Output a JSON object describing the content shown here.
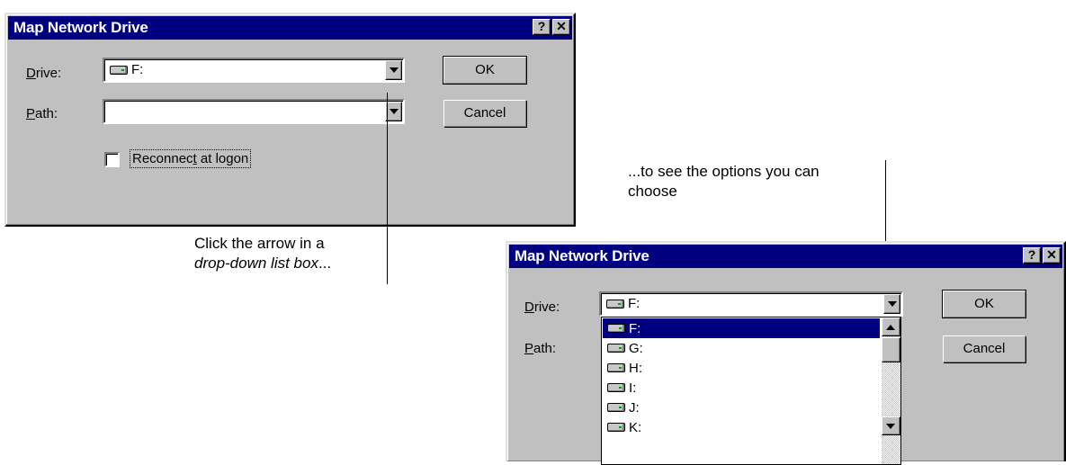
{
  "dialog1": {
    "title": "Map Network Drive",
    "help_btn": "?",
    "close_btn": "✕",
    "drive": {
      "label_ul": "D",
      "label_rest": "rive:",
      "value": "F:"
    },
    "path": {
      "label_ul": "P",
      "label_rest": "ath:",
      "value": ""
    },
    "reconnect": {
      "label_pre": "Reconnec",
      "label_ul": "t",
      "label_post": " at logon",
      "checked": false
    },
    "ok_label": "OK",
    "cancel_label": "Cancel"
  },
  "dialog2": {
    "title": "Map Network Drive",
    "help_btn": "?",
    "close_btn": "✕",
    "drive": {
      "label_ul": "D",
      "label_rest": "rive:",
      "value": "F:"
    },
    "path": {
      "label_ul": "P",
      "label_rest": "ath:"
    },
    "ok_label": "OK",
    "cancel_label": "Cancel",
    "options": [
      "F:",
      "G:",
      "H:",
      "I:",
      "J:",
      "K:"
    ],
    "selected_option": "F:"
  },
  "annotations": {
    "click_line1": "Click the arrow in a",
    "click_line2": "drop-down list box",
    "click_line2_suffix": "...",
    "see_line1": "...to see the options you can",
    "see_line2": "choose"
  },
  "colors": {
    "titlebar": "#000080",
    "dialog_face": "#c0c0c0",
    "selection": "#000080"
  },
  "icons": {
    "drive": "network-drive-icon",
    "dropdown": "chevron-down-icon",
    "help": "help-icon",
    "close": "close-icon"
  }
}
